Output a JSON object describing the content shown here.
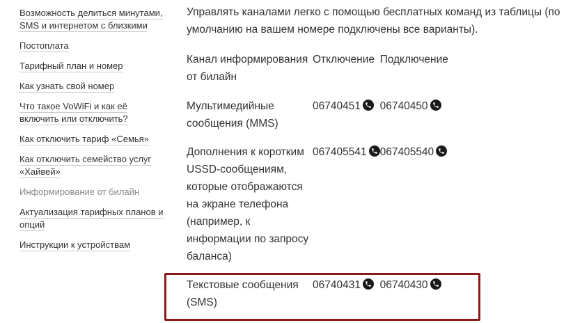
{
  "sidebar": {
    "items": [
      {
        "label": "Возможность делиться минутами,\nSMS и интернетом с близкими"
      },
      {
        "label": "Постоплата"
      },
      {
        "label": "Тарифный план и номер"
      },
      {
        "label": "Как узнать свой номер"
      },
      {
        "label": "Что такое VoWiFi и как её включить или отключить?"
      },
      {
        "label": "Как отключить тариф «Семья»"
      },
      {
        "label": "Как отключить семейство услуг «Хайвей»"
      },
      {
        "label": "Информирование от билайн",
        "current": true
      },
      {
        "label": "Актуализация тарифных планов и опций"
      },
      {
        "label": "Инструкции к устройствам"
      }
    ]
  },
  "main": {
    "intro": "Управлять каналами легко с помощью бесплатных команд из таблицы (по умолчанию на вашем номере подключены все варианты).",
    "table": {
      "headers": {
        "channel": "Канал информирования от билайн",
        "off": "Отключение",
        "on": "Подключение"
      },
      "rows": [
        {
          "channel": "Мультимедийные сообщения (MMS)",
          "off": "06740451",
          "on": "06740450"
        },
        {
          "channel": "Дополнения к коротким USSD-сообщениям, которые отображаются на экране телефона (например, к информации по запросу баланса)",
          "off": "067405541",
          "on": "067405540"
        },
        {
          "channel": "Текстовые сообщения (SMS)",
          "off": "06740431",
          "on": "06740430"
        }
      ]
    }
  },
  "icons": {
    "call": "phone-call-icon"
  },
  "colors": {
    "highlight_border": "#8b1a1a",
    "text": "#333333",
    "muted": "#8a8a8a"
  }
}
